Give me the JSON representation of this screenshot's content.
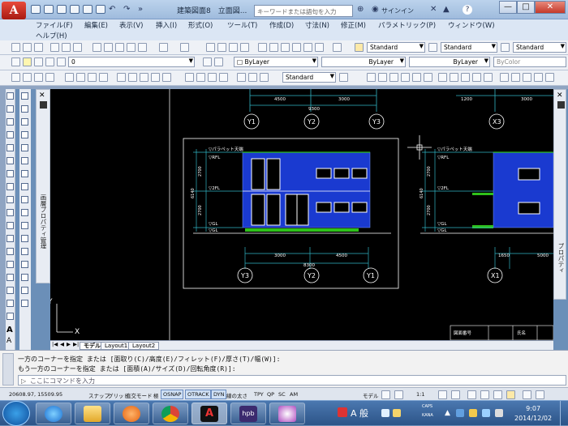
{
  "titlebar": {
    "app_icon": "A",
    "doc_title": "建築図面8　立面図...",
    "search_placeholder": "キーワードまたは語句を入力",
    "signin": "サインイン",
    "help": "?",
    "window_controls": [
      "—",
      "□",
      "✕"
    ]
  },
  "menu": {
    "items": [
      "ファイル(F)",
      "編集(E)",
      "表示(V)",
      "挿入(I)",
      "形式(O)",
      "ツール(T)",
      "作成(D)",
      "寸法(N)",
      "修正(M)",
      "パラメトリック(P)",
      "ウィンドウ(W)"
    ],
    "help": "ヘルプ(H)"
  },
  "toolbar_styles": {
    "text_style": "Standard",
    "dim_style": "Standard",
    "table_style": "Standard",
    "multileader_style": "Standard"
  },
  "toolbar_layers": {
    "layer": "0",
    "color": "ByLayer",
    "linetype": "ByLayer",
    "lineweight": "ByLayer",
    "plotstyle": "ByColor"
  },
  "toolbar_dims": {
    "dim_style": "Standard"
  },
  "panels": {
    "left_properties": "画層プロパティ管理",
    "right_properties": "プロパティ"
  },
  "drawing": {
    "dims_top": [
      "4500",
      "3000",
      "9300",
      "1200",
      "3000"
    ],
    "grid_top": [
      "Y1",
      "Y2",
      "Y3",
      "X3"
    ],
    "levels_left": [
      "▽パラペット天端",
      "▽RFL",
      "▽2FL",
      "▽GL",
      "▽GL"
    ],
    "levels_right": [
      "▽パラペット天端",
      "▽RFL",
      "▽2FL",
      "▽GL",
      "▽GL"
    ],
    "vert_dims_left": [
      "2700",
      "6140",
      "2700"
    ],
    "vert_dims_right": [
      "2700",
      "6140",
      "2700"
    ],
    "dims_bottom_left": [
      "3000",
      "4500",
      "8300"
    ],
    "dims_bottom_right": [
      "1650",
      "5000"
    ],
    "grid_bottom": [
      "Y3",
      "Y2",
      "Y1",
      "X1"
    ],
    "titleblock_labels": [
      "図面番号",
      "氏名"
    ],
    "ucs_x": "X",
    "ucs_y": "Y"
  },
  "tabs": {
    "nav": [
      "|◀",
      "◀",
      "▶",
      "▶|"
    ],
    "model": "モデル",
    "layout1": "Layout1",
    "layout2": "Layout2"
  },
  "command": {
    "line1": "一方のコーナーを指定 または [面取り(C)/高度(E)/フィレット(F)/厚さ(T)/幅(W)]:",
    "line2": "もう一方のコーナーを指定 または [面積(A)/サイズ(D)/回転角度(R)]:",
    "placeholder": "ここにコマンドを入力"
  },
  "statusbar": {
    "coords": "20608.97, 15509.95",
    "toggles": [
      "スナップ",
      "グリッド",
      "直交モード",
      "極",
      "OSNAP",
      "OTRACK",
      "DYN",
      "線の太さ",
      "TPY",
      "QP",
      "SC",
      "AM"
    ],
    "active_toggles": [
      "OSNAP",
      "OTRACK",
      "DYN"
    ],
    "model": "モデル",
    "scale": "1:1"
  },
  "taskbar": {
    "ime": "A 般",
    "time": "9:07",
    "date": "2014/12/02",
    "input_mode_1": "CAPS",
    "input_mode_2": "KANA"
  },
  "colors": {
    "accent": "#cf2a1e",
    "building_fill": "#1a3ad0",
    "dimension_line": "#31b4c4",
    "grid_bubble": "#ffffff",
    "ground_line": "#2ec11a"
  }
}
